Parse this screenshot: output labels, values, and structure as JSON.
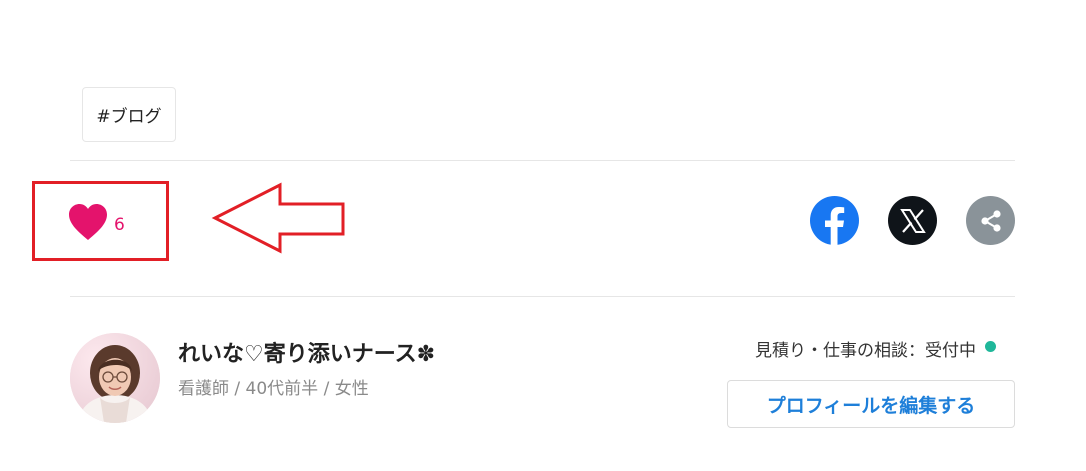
{
  "tags": [
    {
      "label": "#ブログ"
    }
  ],
  "like": {
    "count": "6",
    "icon": "heart-icon",
    "color": "#e4136c"
  },
  "annotation": {
    "highlight_color": "#e21f26"
  },
  "share": {
    "buttons": [
      {
        "name": "facebook",
        "icon": "facebook-icon",
        "color": "#1877f2"
      },
      {
        "name": "x",
        "icon": "x-logo-icon",
        "color": "#0f1419"
      },
      {
        "name": "share",
        "icon": "share-icon",
        "color": "#8a9399"
      }
    ]
  },
  "profile": {
    "name": "れいな♡寄り添いナース✽",
    "meta": "看護師 / 40代前半 / 女性",
    "status": "見積り・仕事の相談：受付中",
    "status_color": "#1fb79a",
    "edit_button": "プロフィールを編集する",
    "edit_button_color": "#1e7fd9"
  }
}
